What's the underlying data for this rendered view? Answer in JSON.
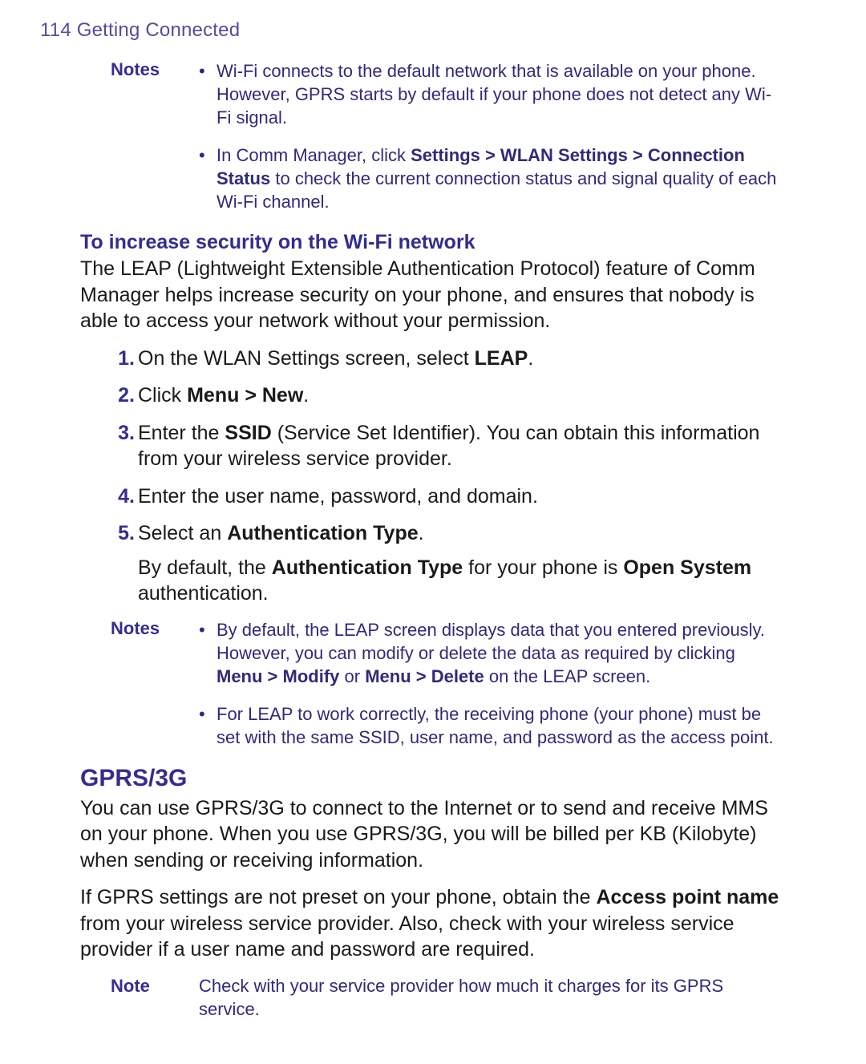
{
  "running_head": "114  Getting Connected",
  "notes1": {
    "label": "Notes",
    "items": [
      {
        "pre": "Wi-Fi connects to the default network that is available on your phone. However, GPRS starts by default if your phone does not detect any Wi-Fi signal."
      },
      {
        "pre": "In Comm Manager, click ",
        "bold1": "Settings > WLAN Settings > Connection Status",
        "post": " to check the current connection status and signal quality of each Wi-Fi channel."
      }
    ]
  },
  "subhead1": "To increase security on the Wi-Fi network",
  "intro1": "The LEAP (Lightweight Extensible Authentication Protocol) feature of Comm Manager helps increase security on your phone, and ensures that nobody is able to access your network without your permission.",
  "steps": [
    {
      "pre": "On the WLAN Settings screen, select ",
      "bold1": "LEAP",
      "post": "."
    },
    {
      "pre": "Click ",
      "bold1": "Menu > New",
      "post": "."
    },
    {
      "pre": "Enter the ",
      "bold1": "SSID",
      "post": " (Service Set Identifier). You can obtain this information from your wireless service provider."
    },
    {
      "pre": "Enter the user name, password, and domain."
    },
    {
      "pre": "Select an ",
      "bold1": "Authentication Type",
      "post": ".",
      "follow_pre": "By default, the ",
      "follow_b1": "Authentication Type",
      "follow_mid": " for your phone is ",
      "follow_b2": "Open System",
      "follow_post": " authentication."
    }
  ],
  "notes2": {
    "label": "Notes",
    "items": [
      {
        "pre": "By default, the LEAP screen displays data that you entered previously. However, you can modify or delete the data as required by clicking ",
        "bold1": "Menu > Modify",
        "mid": " or ",
        "bold2": "Menu > Delete",
        "post": " on the LEAP screen."
      },
      {
        "pre": "For LEAP to work correctly, the receiving phone (your phone) must be set with the same SSID, user name, and password as the access point."
      }
    ]
  },
  "section_head": "GPRS/3G",
  "gprs_p1": "You can use GPRS/3G to connect to the Internet or to send and receive MMS on your phone. When you use GPRS/3G, you will be billed per KB (Kilobyte) when sending or receiving information.",
  "gprs_p2_pre": "If GPRS settings are not preset on your phone, obtain the ",
  "gprs_p2_bold": "Access point name",
  "gprs_p2_post": " from your wireless service provider. Also, check with your wireless service provider if a user name and password are required.",
  "note3": {
    "label": "Note",
    "text": "Check with your service provider how much it charges for its GPRS service."
  }
}
